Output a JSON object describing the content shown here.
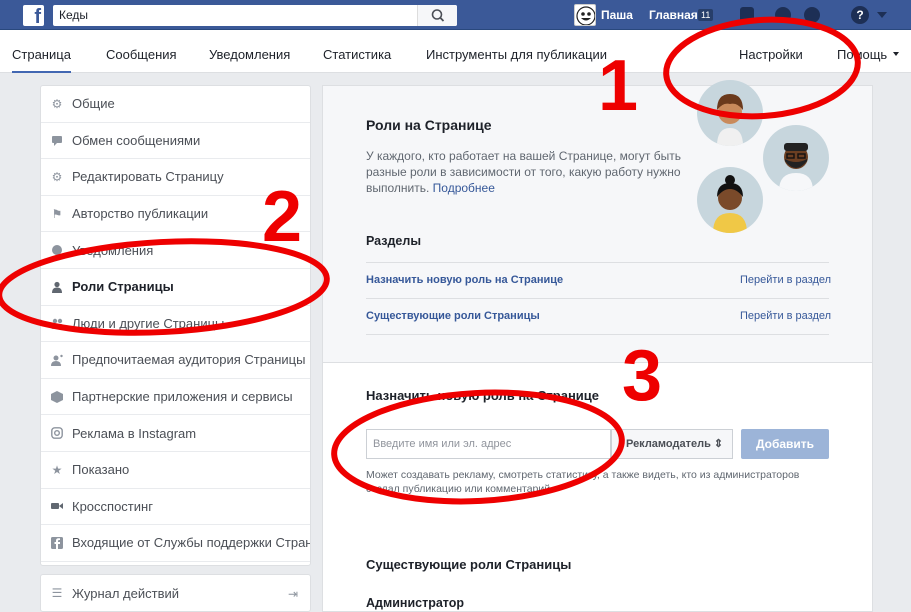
{
  "topbar": {
    "search_value": "Кеды",
    "user_name": "Паша",
    "home_label": "Главная",
    "home_count": "11"
  },
  "subnav": {
    "tabs": [
      "Страница",
      "Сообщения",
      "Уведомления",
      "Статистика",
      "Инструменты для публикации"
    ],
    "settings_label": "Настройки",
    "help_label": "Помощь"
  },
  "sidebar": {
    "items": [
      {
        "label": "Общие",
        "icon": "gear-icon"
      },
      {
        "label": "Обмен сообщениями",
        "icon": "chat-icon"
      },
      {
        "label": "Редактировать Страницу",
        "icon": "gear-icon"
      },
      {
        "label": "Авторство публикации",
        "icon": "flag-icon"
      },
      {
        "label": "Уведомления",
        "icon": "globe-icon"
      },
      {
        "label": "Роли Страницы",
        "icon": "person-icon"
      },
      {
        "label": "Люди и другие Страницы",
        "icon": "people-icon"
      },
      {
        "label": "Предпочитаемая аудитория Страницы",
        "icon": "audience-icon"
      },
      {
        "label": "Партнерские приложения и сервисы",
        "icon": "cube-icon"
      },
      {
        "label": "Реклама в Instagram",
        "icon": "instagram-icon"
      },
      {
        "label": "Показано",
        "icon": "star-icon"
      },
      {
        "label": "Кросспостинг",
        "icon": "video-icon"
      },
      {
        "label": "Входящие от Службы поддержки Страни",
        "icon": "facebook-icon"
      }
    ],
    "active_index": 5
  },
  "activity_log": {
    "label": "Журнал действий",
    "icon": "list-icon"
  },
  "roles": {
    "title": "Роли на Странице",
    "description": "У каждого, кто работает на вашей Странице, могут быть разные роли в зависимости от того, какую работу нужно выполнить.",
    "more_link": "Подробнее",
    "sections_title": "Разделы",
    "sections": [
      {
        "label": "Назначить новую роль на Странице",
        "link": "Перейти в раздел"
      },
      {
        "label": "Существующие роли Страницы",
        "link": "Перейти в раздел"
      }
    ]
  },
  "assign": {
    "title": "Назначить новую роль на Странице",
    "input_placeholder": "Введите имя или эл. адрес",
    "role_value": "Рекламодатель ⇕",
    "add_label": "Добавить",
    "hint": "Может создавать рекламу, смотреть статистику, а также видеть, кто из администраторов создал публикацию или комментарий."
  },
  "existing": {
    "title": "Существующие роли Страницы",
    "admin_label": "Администратор"
  },
  "annotations": {
    "marks": [
      "1",
      "2",
      "3"
    ],
    "color": "#ee0000"
  },
  "colors": {
    "brand": "#3b5998",
    "link": "#365899",
    "button": "#9cb4d8"
  }
}
